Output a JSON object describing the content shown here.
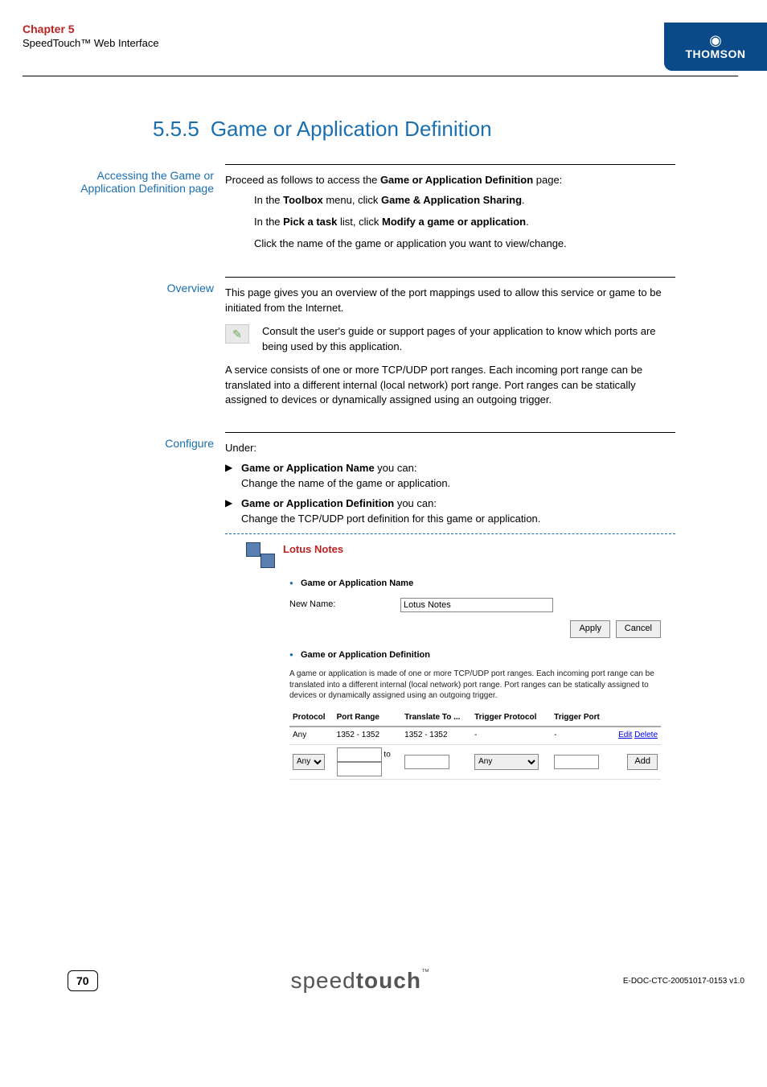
{
  "header": {
    "chapter_title": "Chapter 5",
    "chapter_sub": "SpeedTouch™ Web Interface",
    "brand": "THOMSON"
  },
  "section": {
    "number": "5.5.5",
    "title": "Game or Application Definition"
  },
  "access": {
    "label": "Accessing the Game or Application Definition page",
    "intro_pre": "Proceed as follows to access the ",
    "intro_bold": "Game or Application Definition",
    "intro_post": " page:",
    "steps": {
      "s1_a": "In the ",
      "s1_b": "Toolbox",
      "s1_c": " menu, click ",
      "s1_d": "Game & Application Sharing",
      "s1_e": ".",
      "s2_a": "In the ",
      "s2_b": "Pick a task",
      "s2_c": " list, click ",
      "s2_d": "Modify a game or application",
      "s2_e": ".",
      "s3": "Click the name of the game or application you want to view/change."
    }
  },
  "overview": {
    "label": "Overview",
    "p1": "This page gives you an overview of the port mappings used to allow this service or game to be initiated from the Internet.",
    "consult": "Consult the user's guide or support pages of your application to know which ports are being used by this application.",
    "p2": "A service consists of one or more TCP/UDP port ranges. Each incoming port range can be translated into a different internal (local network) port range. Port ranges can be statically assigned to devices or dynamically assigned using an outgoing trigger."
  },
  "configure": {
    "label": "Configure",
    "under": "Under:",
    "b1_bold": "Game or Application Name",
    "b1_rest": " you can:",
    "b1_sub": "Change the name of the game or application.",
    "b2_bold": "Game or Application Definition",
    "b2_rest": " you can:",
    "b2_sub": "Change the TCP/UDP port definition for this game or application."
  },
  "panel": {
    "title": "Lotus Notes",
    "name_section": "Game or Application Name",
    "new_name_label": "New Name:",
    "new_name_value": "Lotus Notes",
    "apply": "Apply",
    "cancel": "Cancel",
    "def_section": "Game or Application Definition",
    "def_desc": "A game or application is made of one or more TCP/UDP port ranges. Each incoming port range can be translated into a different internal (local network) port range. Port ranges can be statically assigned to devices or dynamically assigned using an outgoing trigger.",
    "headers": {
      "protocol": "Protocol",
      "port_range": "Port Range",
      "translate_to": "Translate To ...",
      "trigger_protocol": "Trigger Protocol",
      "trigger_port": "Trigger Port"
    },
    "row1": {
      "protocol": "Any",
      "port_range": "1352 - 1352",
      "translate_to": "1352 - 1352",
      "trigger_protocol": "-",
      "trigger_port": "-",
      "edit": "Edit",
      "delete": "Delete"
    },
    "row2": {
      "protocol_sel": "Any",
      "to_label": "to",
      "trigger_sel": "Any",
      "add": "Add"
    }
  },
  "footer": {
    "page": "70",
    "logo_a": "speed",
    "logo_b": "touch",
    "tm": "™",
    "doc_id": "E-DOC-CTC-20051017-0153 v1.0"
  }
}
